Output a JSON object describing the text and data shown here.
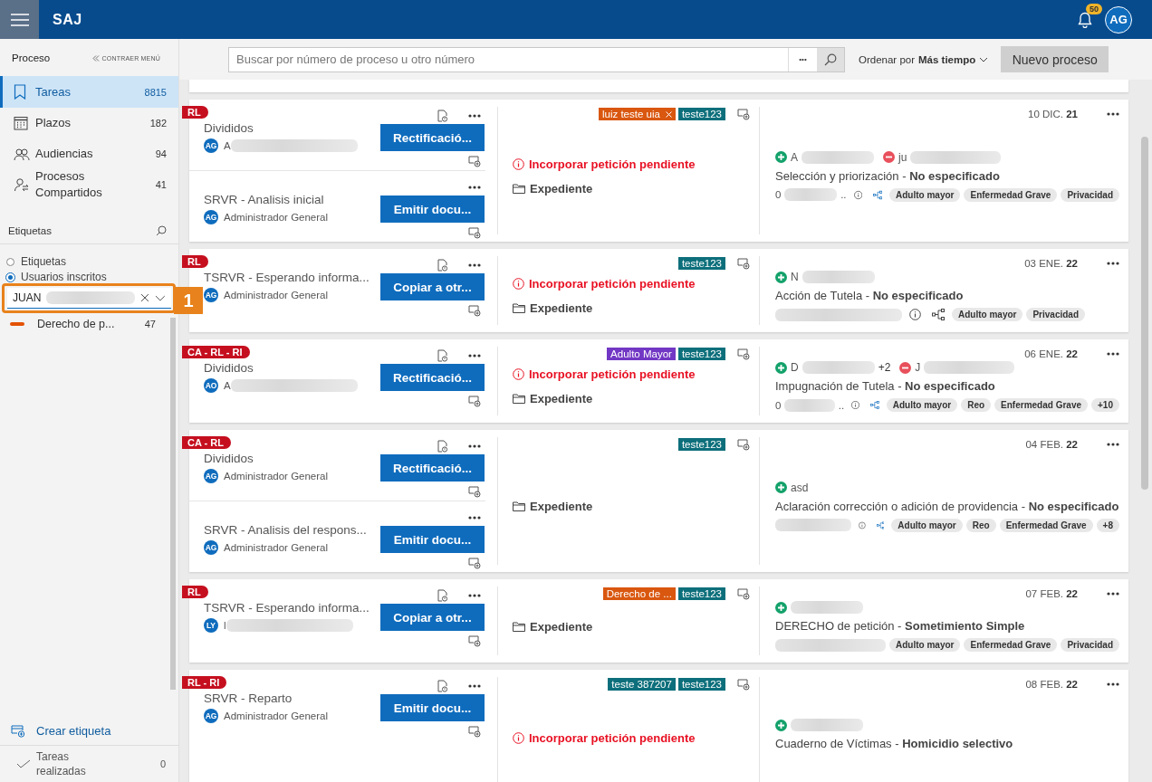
{
  "topbar": {
    "app_name": "SAJ",
    "notifications": "50",
    "avatar": "AG"
  },
  "sidebar": {
    "title": "Proceso",
    "collapse": "CONTRAER MENÚ",
    "nav": [
      {
        "kind": "tasks",
        "label": "Tareas",
        "count": "8815",
        "selected": true
      },
      {
        "kind": "calendar",
        "label": "Plazos",
        "count": "182",
        "selected": false
      },
      {
        "kind": "people",
        "label": "Audiencias",
        "count": "94",
        "selected": false
      },
      {
        "kind": "shared",
        "label": "Procesos Compartidos",
        "count": "41",
        "selected": false
      }
    ],
    "labels_title": "Etiquetas",
    "filters": [
      {
        "label": "Etiquetas",
        "selected": false
      },
      {
        "label": "Usuarios inscritos",
        "selected": true
      }
    ],
    "user_select": {
      "value": "JUAN"
    },
    "callout": "1",
    "labels": [
      {
        "name": "Derecho de p...",
        "count": "47",
        "color": "#e35205"
      }
    ],
    "create_label": "Crear etiqueta",
    "done": {
      "label": "Tareas realizadas",
      "count": "0"
    }
  },
  "toolbar": {
    "search_placeholder": "Buscar por número de proceso u otro número",
    "more": "•••",
    "sort": "Ordenar por **Más tiempo**",
    "new_button": "Nuevo proceso"
  },
  "cards": [
    {
      "flag": "RL",
      "tasks": [
        {
          "title": "Divididos",
          "assignee": {
            "initials": "AG",
            "text": "A",
            "blurred": true
          },
          "action": "Rectificació..."
        },
        {
          "title": "SRVR - Analisis inicial",
          "assignee": {
            "initials": "AG",
            "text": "Administrador General",
            "blurred": false
          },
          "action": "Emitir docu..."
        }
      ],
      "tags": [
        {
          "text": "luiz teste uia",
          "color": "#d9570f",
          "removable": true
        },
        {
          "text": "teste123",
          "color": "#0d6f7b",
          "removable": false
        }
      ],
      "alert": "Incorporar petición pendiente",
      "folder": "Expediente",
      "date": "10 DIC. **21**",
      "parties": [
        {
          "kind": "plus",
          "text": "A",
          "blurred": true
        },
        {
          "kind": "minus",
          "text": "ju",
          "blurred": true
        }
      ],
      "subject": "Selección y priorización - **No especificado**",
      "ref_start": "0",
      "ref_end": "..",
      "info": true,
      "linked": true,
      "chips": [
        "Adulto mayor",
        "Enfermedad Grave",
        "Privacidad"
      ]
    },
    {
      "flag": "RL",
      "tasks": [
        {
          "title": "TSRVR - Esperando informa...",
          "assignee": {
            "initials": "AG",
            "text": "Administrador General",
            "blurred": false
          },
          "action": "Copiar a otr..."
        }
      ],
      "tags": [
        {
          "text": "teste123",
          "color": "#0d6f7b",
          "removable": false
        }
      ],
      "alert": "Incorporar petición pendiente",
      "folder": "Expediente",
      "date": "03 ENE. **22**",
      "parties": [
        {
          "kind": "plus",
          "text": "N",
          "blurred": true
        }
      ],
      "subject": "Acción de Tutela - **No especificado**",
      "info": true,
      "linked": false,
      "chips": [
        "Adulto mayor",
        "Privacidad"
      ]
    },
    {
      "flag": "CA - RL - RI",
      "tasks": [
        {
          "title": "Divididos",
          "assignee": {
            "initials": "AO",
            "text": "A",
            "blurred": true
          },
          "action": "Rectificació..."
        }
      ],
      "tags": [
        {
          "text": "Adulto Mayor",
          "color": "#7237c4",
          "removable": false
        },
        {
          "text": "teste123",
          "color": "#0d6f7b",
          "removable": false
        }
      ],
      "alert": "Incorporar petición pendiente",
      "folder": "Expediente",
      "date": "06 ENE. **22**",
      "parties": [
        {
          "kind": "plus",
          "text": "D",
          "blurred": true,
          "extra": "+2"
        },
        {
          "kind": "minus",
          "text": "J",
          "blurred": true
        }
      ],
      "subject": "Impugnación de Tutela - **No especificado**",
      "ref_start": "0",
      "ref_end": "..",
      "info": true,
      "linked": true,
      "chips": [
        "Adulto mayor",
        "Reo",
        "Enfermedad Grave",
        "+10"
      ]
    },
    {
      "flag": "CA - RL",
      "tasks": [
        {
          "title": "Divididos",
          "assignee": {
            "initials": "AG",
            "text": "Administrador General",
            "blurred": false
          },
          "action": "Rectificació..."
        },
        {
          "title": "SRVR - Analisis del respons...",
          "assignee": {
            "initials": "AG",
            "text": "Administrador General",
            "blurred": false
          },
          "action": "Emitir docu..."
        }
      ],
      "tags": [
        {
          "text": "teste123",
          "color": "#0d6f7b",
          "removable": false
        }
      ],
      "folder": "Expediente",
      "date": "04 FEB. **22**",
      "parties": [
        {
          "kind": "plus",
          "text": "asd",
          "blurred": false
        }
      ],
      "subject": "Aclaración corrección o adición de providencia - **No especificado**",
      "info": true,
      "linked": true,
      "chips": [
        "Adulto mayor",
        "Reo",
        "Enfermedad Grave",
        "+8"
      ]
    },
    {
      "flag": "RL",
      "tasks": [
        {
          "title": "TSRVR - Esperando informa...",
          "assignee": {
            "initials": "LY",
            "text": "l",
            "blurred": true
          },
          "action": "Copiar a otr..."
        }
      ],
      "tags": [
        {
          "text": "Derecho de ...",
          "color": "#d9570f",
          "removable": false
        },
        {
          "text": "teste123",
          "color": "#0d6f7b",
          "removable": false
        }
      ],
      "folder": "Expediente",
      "date": "07 FEB. **22**",
      "parties": [
        {
          "kind": "plus",
          "blurred": true
        }
      ],
      "subject": "DERECHO de petición - **Sometimiento Simple**",
      "info": false,
      "chips": [
        "Adulto mayor",
        "Enfermedad Grave",
        "Privacidad"
      ]
    },
    {
      "flag": "RL - RI",
      "tasks": [
        {
          "title": "SRVR - Reparto",
          "assignee": {
            "initials": "AG",
            "text": "Administrador General",
            "blurred": false
          },
          "action": "Emitir docu..."
        }
      ],
      "tags": [
        {
          "text": "teste 387207",
          "color": "#0d6f7b",
          "removable": false
        },
        {
          "text": "teste123",
          "color": "#0d6f7b",
          "removable": false
        }
      ],
      "alert": "Incorporar petición pendiente",
      "date": "08 FEB. **22**",
      "parties": [
        {
          "kind": "plus",
          "blurred": true
        }
      ],
      "subject": "Cuaderno de Víctimas - **Homicidio selectivo**"
    }
  ]
}
